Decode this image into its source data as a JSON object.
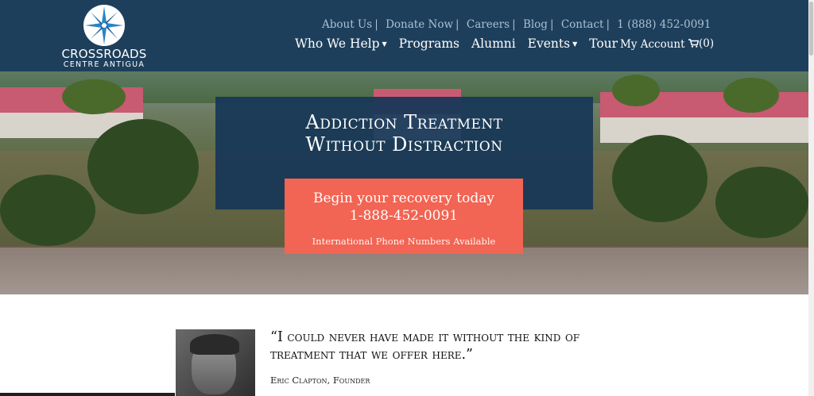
{
  "brand": {
    "name": "CROSSROADS",
    "subtitle": "CENTRE ANTIGUA",
    "logo_icon": "compass-rose-icon"
  },
  "utility_nav": [
    {
      "label": "About Us"
    },
    {
      "label": "Donate Now"
    },
    {
      "label": "Careers"
    },
    {
      "label": "Blog"
    },
    {
      "label": "Contact"
    },
    {
      "label": "1 (888) 452-0091"
    }
  ],
  "main_nav": [
    {
      "label": "Who We Help",
      "dropdown": true
    },
    {
      "label": "Programs",
      "dropdown": false
    },
    {
      "label": "Alumni",
      "dropdown": false
    },
    {
      "label": "Events",
      "dropdown": true
    },
    {
      "label": "Tour",
      "dropdown": false
    }
  ],
  "account": {
    "label": "My Account"
  },
  "cart": {
    "icon": "cart-icon",
    "count_label": "(0)"
  },
  "hero": {
    "title_line1": "Addiction Treatment",
    "title_line2": "Without Distraction",
    "cta_line1": "Begin your recovery today",
    "cta_phone": "1-888-452-0091",
    "cta_note": "International Phone Numbers Available"
  },
  "testimonial": {
    "quote": "“I could never have made it without the kind of treatment that we offer here.”",
    "author": "Eric Clapton, Founder"
  },
  "colors": {
    "header": "#1e3f5b",
    "hero_box": "#173757",
    "cta": "#f26453",
    "util_link": "#a9c0d2"
  }
}
